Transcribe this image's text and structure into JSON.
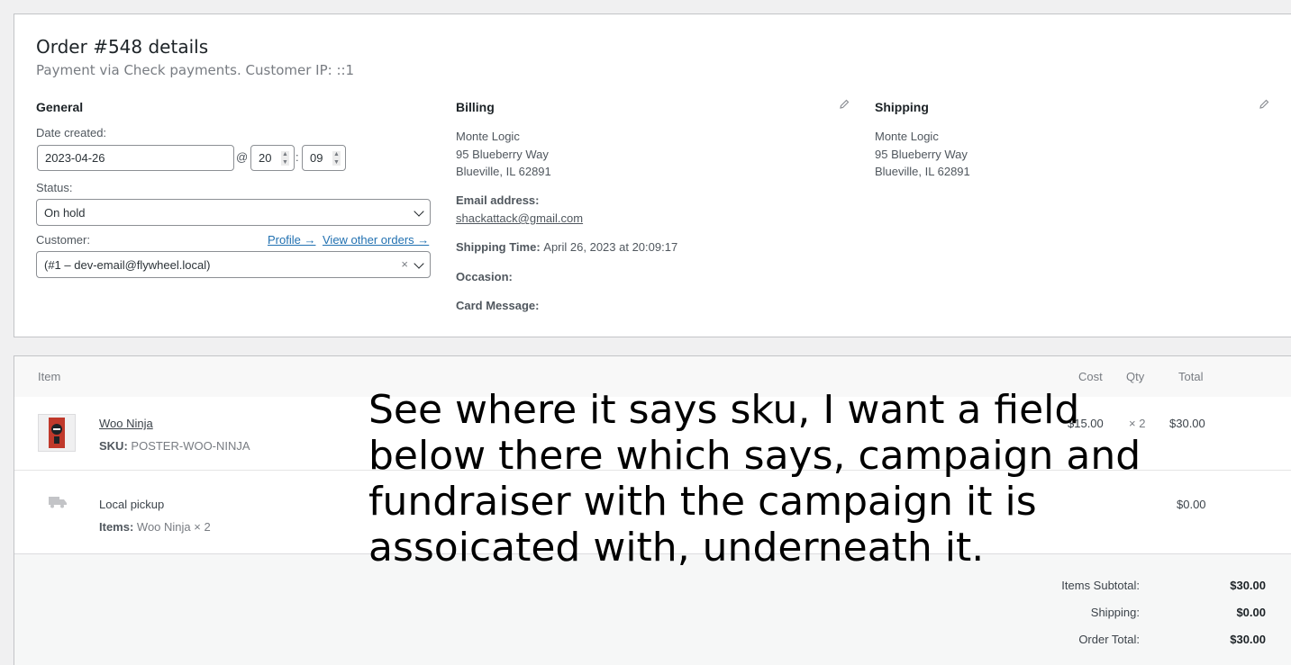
{
  "order": {
    "title": "Order #548 details",
    "subtitle": "Payment via Check payments. Customer IP: ::1"
  },
  "general": {
    "heading": "General",
    "date_label": "Date created:",
    "date_value": "2023-04-26",
    "at_sign": "@",
    "hour_value": "20",
    "minute_value": "09",
    "colon": ":",
    "status_label": "Status:",
    "status_value": "On hold",
    "customer_label": "Customer:",
    "profile_link": "Profile →",
    "other_orders_link": "View other orders →",
    "customer_value": "(#1 – dev-email@flywheel.local)",
    "clear_glyph": "×"
  },
  "billing": {
    "heading": "Billing",
    "name": "Monte Logic",
    "street": "95 Blueberry Way",
    "city": "Blueville, IL 62891",
    "email_label": "Email address:",
    "email_value": "shackattack@gmail.com",
    "shipping_time_label": "Shipping Time:",
    "shipping_time_value": "April 26, 2023 at 20:09:17",
    "occasion_label": "Occasion:",
    "card_message_label": "Card Message:"
  },
  "shipping": {
    "heading": "Shipping",
    "name": "Monte Logic",
    "street": "95 Blueberry Way",
    "city": "Blueville, IL 62891"
  },
  "items": {
    "headers": {
      "item": "Item",
      "cost": "Cost",
      "qty": "Qty",
      "total": "Total"
    },
    "product": {
      "name": "Woo Ninja",
      "sku_label": "SKU:",
      "sku_value": "POSTER-WOO-NINJA",
      "cost": "$15.00",
      "qty": "× 2",
      "total": "$30.00"
    },
    "shipping_line": {
      "name": "Local pickup",
      "items_label": "Items:",
      "items_value": "Woo Ninja × 2",
      "total": "$0.00"
    }
  },
  "totals": {
    "subtotal_label": "Items Subtotal:",
    "subtotal_value": "$30.00",
    "shipping_label": "Shipping:",
    "shipping_value": "$0.00",
    "order_total_label": "Order Total:",
    "order_total_value": "$30.00"
  },
  "annotation": "See where it says sku, I want a field below there which says, campaign and fundraiser with the campaign it is assoicated with, underneath it.",
  "colors": {
    "link": "#2271b1",
    "border": "#c3c4c7",
    "background": "#f0f0f1"
  },
  "icons": [
    "pencil-icon",
    "chevron-down-icon",
    "spinner-icon",
    "truck-icon",
    "product-thumbnail"
  ]
}
